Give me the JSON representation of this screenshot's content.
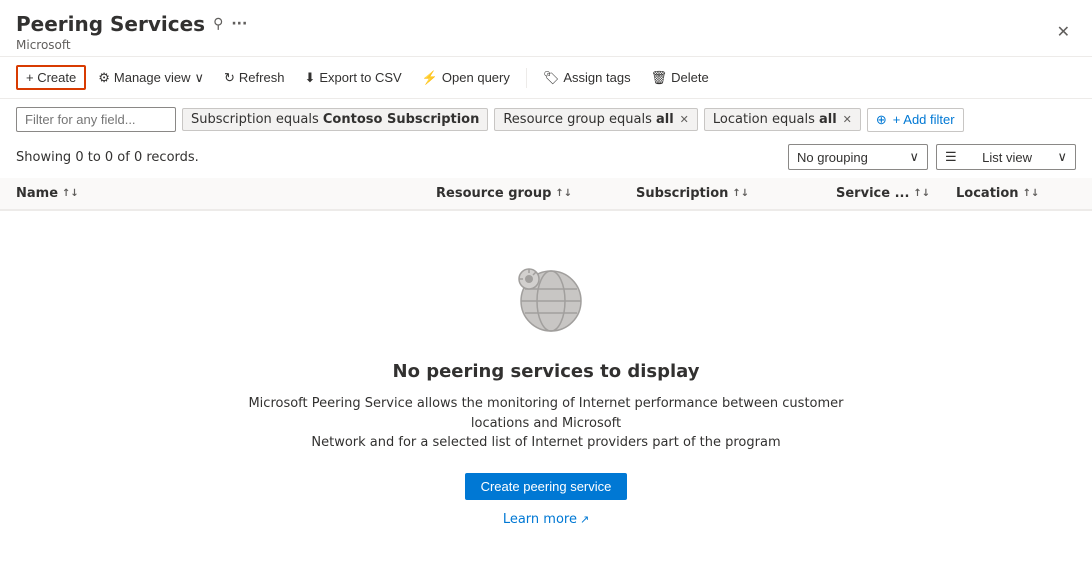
{
  "header": {
    "title": "Peering Services",
    "subtitle": "Microsoft",
    "pin_icon": "📌",
    "ellipsis_icon": "...",
    "close_icon": "✕"
  },
  "toolbar": {
    "create_label": "+ Create",
    "manage_view_label": "Manage view",
    "refresh_label": "Refresh",
    "export_label": "Export to CSV",
    "query_label": "Open query",
    "assign_tags_label": "Assign tags",
    "delete_label": "Delete"
  },
  "filters": {
    "placeholder": "Filter for any field...",
    "tags": [
      {
        "key": "Subscription equals",
        "value": "Contoso Subscription",
        "removable": false
      },
      {
        "key": "Resource group equals",
        "value": "all",
        "removable": true
      },
      {
        "key": "Location equals",
        "value": "all",
        "removable": true
      }
    ],
    "add_filter_label": "+ Add filter"
  },
  "results": {
    "summary": "Showing 0 to 0 of 0 records.",
    "grouping_label": "No grouping",
    "view_label": "List view"
  },
  "table": {
    "columns": [
      {
        "label": "Name",
        "sortable": true
      },
      {
        "label": "Resource group",
        "sortable": true
      },
      {
        "label": "Subscription",
        "sortable": true
      },
      {
        "label": "Service ...",
        "sortable": true
      },
      {
        "label": "Location",
        "sortable": true
      }
    ]
  },
  "empty_state": {
    "title": "No peering services to display",
    "description_part1": "Microsoft Peering Service allows the monitoring of Internet performance between customer locations and Microsoft",
    "description_part2": "Network and for a selected list of Internet providers part of the program",
    "create_button_label": "Create peering service",
    "learn_more_label": "Learn more",
    "learn_more_icon": "↗"
  },
  "icons": {
    "pin": "⚲",
    "close": "✕",
    "refresh": "↻",
    "export": "⬇",
    "query": "⚡",
    "tag": "🏷",
    "delete": "🗑",
    "gear": "⚙",
    "chevron_down": "∨",
    "sort": "↑↓",
    "sort_up": "↑",
    "sort_down": "↓",
    "list_view": "☰",
    "plus_filter": "⊕"
  }
}
